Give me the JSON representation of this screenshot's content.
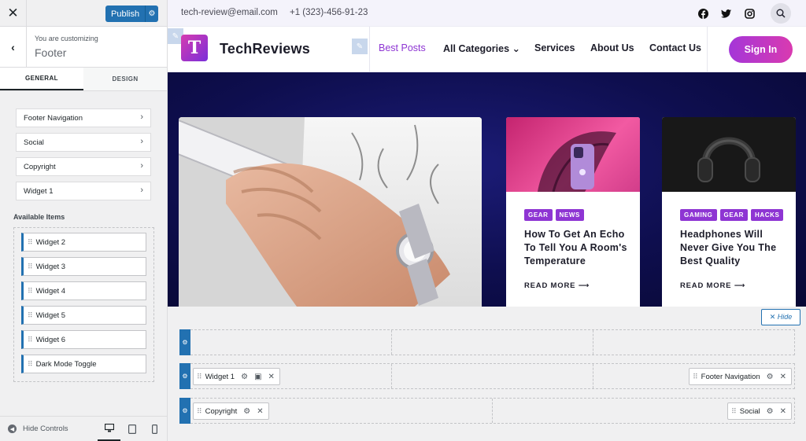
{
  "customizer": {
    "close_label": "✕",
    "publish_label": "Publish",
    "subtitle": "You are customizing",
    "title": "Footer",
    "tabs": [
      {
        "label": "GENERAL"
      },
      {
        "label": "DESIGN"
      }
    ],
    "nav_items": [
      {
        "label": "Footer Navigation"
      },
      {
        "label": "Social"
      },
      {
        "label": "Copyright"
      },
      {
        "label": "Widget 1"
      }
    ],
    "available_title": "Available Items",
    "available_items": [
      {
        "label": "Widget 2"
      },
      {
        "label": "Widget 3"
      },
      {
        "label": "Widget 4"
      },
      {
        "label": "Widget 5"
      },
      {
        "label": "Widget 6"
      },
      {
        "label": "Dark Mode Toggle"
      }
    ],
    "hide_controls": "Hide Controls"
  },
  "site": {
    "email": "tech-review@email.com",
    "phone": "+1 (323)-456-91-23",
    "logo_letter": "T",
    "name": "TechReviews",
    "menu": [
      {
        "label": "Best Posts"
      },
      {
        "label": "All Categories ⌄"
      },
      {
        "label": "Services"
      },
      {
        "label": "About Us"
      },
      {
        "label": "Contact Us"
      }
    ],
    "signin": "Sign In",
    "cards": [
      {
        "tags": [
          "GEAR",
          "NEWS"
        ],
        "title": "How To Get An Echo To Tell You A Room's Temperature",
        "read_more": "READ MORE ⟶"
      },
      {
        "tags": [
          "GAMING",
          "GEAR",
          "HACKS"
        ],
        "title": "Headphones Will Never Give You The Best Quality",
        "read_more": "READ MORE ⟶"
      }
    ],
    "accent": "#8e35d3"
  },
  "builder": {
    "hide_label": "✕ Hide",
    "row2_left": "Widget 1",
    "row2_right": "Footer Navigation",
    "row3_left": "Copyright",
    "row3_right": "Social"
  }
}
